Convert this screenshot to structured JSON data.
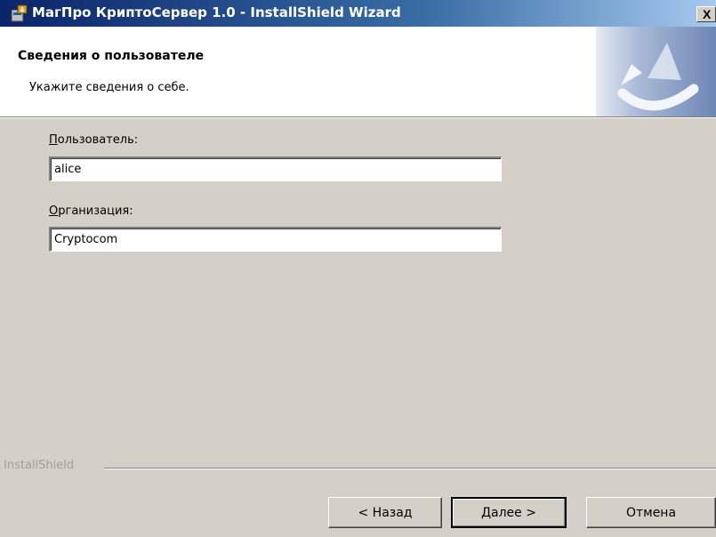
{
  "window": {
    "title": "МагПро КриптоСервер 1.0 - InstallShield Wizard",
    "close_label": "X"
  },
  "header": {
    "title": "Сведения о пользователе",
    "subtitle": "Укажите сведения о себе."
  },
  "form": {
    "user": {
      "label_accel": "П",
      "label_rest": "ользователь:",
      "value": "alice"
    },
    "org": {
      "label_accel": "О",
      "label_rest": "рганизация:",
      "value": "Cryptocom"
    }
  },
  "footer": {
    "brand": "InstallShield",
    "back_label": "< Назад",
    "next_label": "Далее >",
    "cancel_label": "Отмена"
  },
  "colors": {
    "titlebar_start": "#0a246a",
    "titlebar_end": "#a6caf0",
    "dialog_bg": "#d4d0c8"
  }
}
